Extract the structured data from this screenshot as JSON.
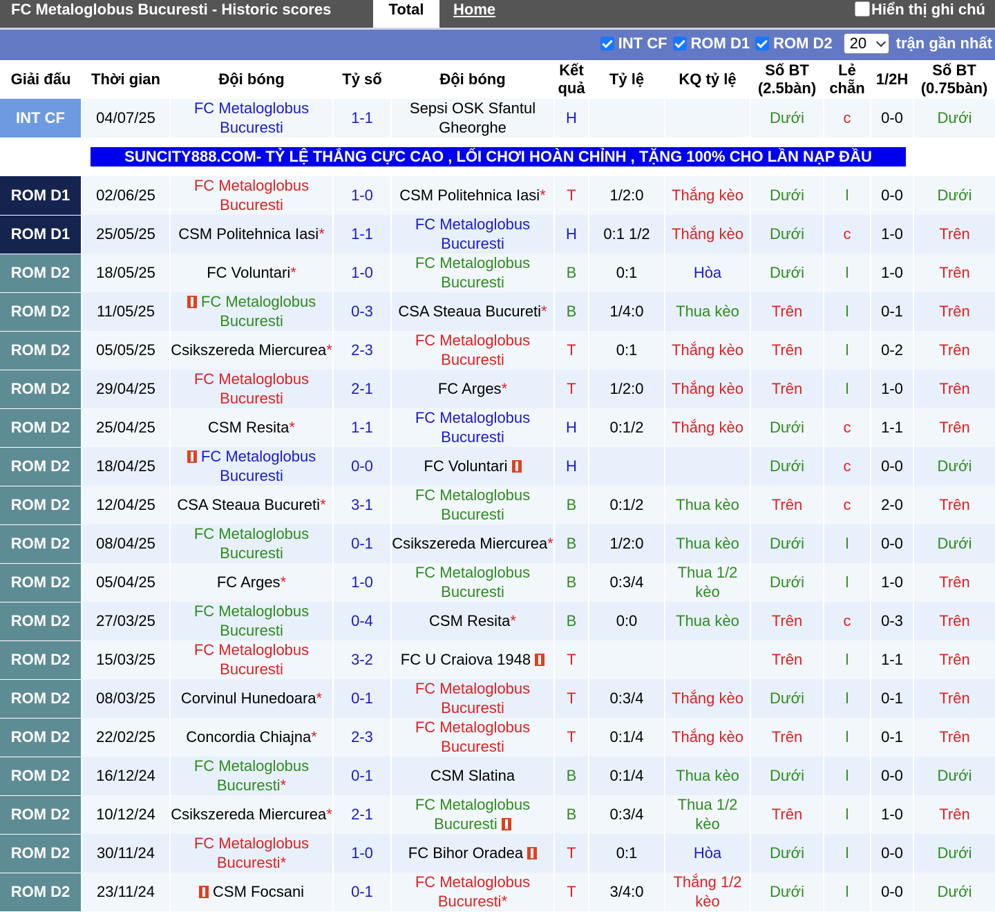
{
  "header": {
    "title": "FC Metaloglobus Bucuresti - Historic scores",
    "tab_total": "Total",
    "tab_home": "Home",
    "show_notes": "Hiển thị ghi chú"
  },
  "filters": {
    "items": [
      "INT CF",
      "ROM D1",
      "ROM D2"
    ],
    "count_value": "20",
    "count_suffix": "trận gần nhất"
  },
  "columns": [
    "Giải đấu",
    "Thời gian",
    "Đội bóng",
    "Tỷ số",
    "Đội bóng",
    "Kết quả",
    "Tỷ lệ",
    "KQ tỷ lệ",
    "Số BT (2.5bàn)",
    "Lẻ chẵn",
    "1/2H",
    "Số BT (0.75bàn)"
  ],
  "ad_text": "SUNCITY888.COM- TỶ LỆ THẮNG CỰC CAO , LỐI CHƠI HOÀN CHỈNH , TẶNG 100% CHO LẦN NẠP ĐẦU",
  "colors": {
    "INT CF": "#6d9ae0",
    "ROM D1": "#15244f",
    "ROM D2": "#5e8c94"
  },
  "matches": [
    {
      "league": "INT CF",
      "date": "04/07/25",
      "home": "FC Metaloglobus Bucuresti",
      "home_c": "blue",
      "score": "1-1",
      "away": "Sepsi OSK Sfantul Gheorghe",
      "away_c": "black",
      "res": "H",
      "res_c": "blue",
      "hc": "",
      "hc_res": "",
      "hc_res_c": "",
      "ou": "Dưới",
      "ou_c": "green",
      "oe": "c",
      "oe_c": "red",
      "ht": "0-0",
      "ou2": "Dưới",
      "ou2_c": "green"
    },
    {
      "league": "ROM D1",
      "date": "02/06/25",
      "home": "FC Metaloglobus Bucuresti",
      "home_c": "red",
      "score": "1-0",
      "away": "CSM Politehnica Iasi",
      "away_star": true,
      "away_c": "black",
      "res": "T",
      "res_c": "red",
      "hc": "1/2:0",
      "hc_res": "Thắng kèo",
      "hc_res_c": "red",
      "ou": "Dưới",
      "ou_c": "green",
      "oe": "l",
      "oe_c": "green",
      "ht": "0-0",
      "ou2": "Dưới",
      "ou2_c": "green"
    },
    {
      "league": "ROM D1",
      "date": "25/05/25",
      "home": "CSM Politehnica Iasi",
      "home_star": true,
      "home_c": "black",
      "score": "1-1",
      "away": "FC Metaloglobus Bucuresti",
      "away_c": "blue",
      "res": "H",
      "res_c": "blue",
      "hc": "0:1 1/2",
      "hc_res": "Thắng kèo",
      "hc_res_c": "red",
      "ou": "Dưới",
      "ou_c": "green",
      "oe": "c",
      "oe_c": "red",
      "ht": "1-0",
      "ou2": "Trên",
      "ou2_c": "red"
    },
    {
      "league": "ROM D2",
      "date": "18/05/25",
      "home": "FC Voluntari",
      "home_star": true,
      "home_c": "black",
      "score": "1-0",
      "away": "FC Metaloglobus Bucuresti",
      "away_c": "green",
      "res": "B",
      "res_c": "green",
      "hc": "0:1",
      "hc_res": "Hòa",
      "hc_res_c": "blue",
      "ou": "Dưới",
      "ou_c": "green",
      "oe": "l",
      "oe_c": "green",
      "ht": "1-0",
      "ou2": "Trên",
      "ou2_c": "red"
    },
    {
      "league": "ROM D2",
      "date": "11/05/25",
      "home": "FC Metaloglobus Bucuresti",
      "home_flag": true,
      "home_c": "green",
      "score": "0-3",
      "away": "CSA Steaua Bucureti",
      "away_star": true,
      "away_c": "black",
      "res": "B",
      "res_c": "green",
      "hc": "1/4:0",
      "hc_res": "Thua kèo",
      "hc_res_c": "green",
      "ou": "Trên",
      "ou_c": "red",
      "oe": "l",
      "oe_c": "green",
      "ht": "0-1",
      "ou2": "Trên",
      "ou2_c": "red"
    },
    {
      "league": "ROM D2",
      "date": "05/05/25",
      "home": "Csikszereda Miercurea",
      "home_star": true,
      "home_c": "black",
      "score": "2-3",
      "away": "FC Metaloglobus Bucuresti",
      "away_c": "red",
      "res": "T",
      "res_c": "red",
      "hc": "0:1",
      "hc_res": "Thắng kèo",
      "hc_res_c": "red",
      "ou": "Trên",
      "ou_c": "red",
      "oe": "l",
      "oe_c": "green",
      "ht": "0-2",
      "ou2": "Trên",
      "ou2_c": "red"
    },
    {
      "league": "ROM D2",
      "date": "29/04/25",
      "home": "FC Metaloglobus Bucuresti",
      "home_c": "red",
      "score": "2-1",
      "away": "FC Arges",
      "away_star": true,
      "away_c": "black",
      "res": "T",
      "res_c": "red",
      "hc": "1/2:0",
      "hc_res": "Thắng kèo",
      "hc_res_c": "red",
      "ou": "Trên",
      "ou_c": "red",
      "oe": "l",
      "oe_c": "green",
      "ht": "1-0",
      "ou2": "Trên",
      "ou2_c": "red"
    },
    {
      "league": "ROM D2",
      "date": "25/04/25",
      "home": "CSM Resita",
      "home_star": true,
      "home_c": "black",
      "score": "1-1",
      "away": "FC Metaloglobus Bucuresti",
      "away_c": "blue",
      "res": "H",
      "res_c": "blue",
      "hc": "0:1/2",
      "hc_res": "Thắng kèo",
      "hc_res_c": "red",
      "ou": "Dưới",
      "ou_c": "green",
      "oe": "c",
      "oe_c": "red",
      "ht": "1-1",
      "ou2": "Trên",
      "ou2_c": "red"
    },
    {
      "league": "ROM D2",
      "date": "18/04/25",
      "home": "FC Metaloglobus Bucuresti",
      "home_flag": true,
      "home_c": "blue",
      "score": "0-0",
      "away": "FC Voluntari",
      "away_flag": true,
      "away_c": "black",
      "res": "H",
      "res_c": "blue",
      "hc": "",
      "hc_res": "",
      "hc_res_c": "",
      "ou": "Dưới",
      "ou_c": "green",
      "oe": "c",
      "oe_c": "red",
      "ht": "0-0",
      "ou2": "Dưới",
      "ou2_c": "green"
    },
    {
      "league": "ROM D2",
      "date": "12/04/25",
      "home": "CSA Steaua Bucureti",
      "home_star": true,
      "home_c": "black",
      "score": "3-1",
      "away": "FC Metaloglobus Bucuresti",
      "away_c": "green",
      "res": "B",
      "res_c": "green",
      "hc": "0:1/2",
      "hc_res": "Thua kèo",
      "hc_res_c": "green",
      "ou": "Trên",
      "ou_c": "red",
      "oe": "c",
      "oe_c": "red",
      "ht": "2-0",
      "ou2": "Trên",
      "ou2_c": "red"
    },
    {
      "league": "ROM D2",
      "date": "08/04/25",
      "home": "FC Metaloglobus Bucuresti",
      "home_c": "green",
      "score": "0-1",
      "away": "Csikszereda Miercurea",
      "away_star": true,
      "away_c": "black",
      "res": "B",
      "res_c": "green",
      "hc": "1/2:0",
      "hc_res": "Thua kèo",
      "hc_res_c": "green",
      "ou": "Dưới",
      "ou_c": "green",
      "oe": "l",
      "oe_c": "green",
      "ht": "0-0",
      "ou2": "Dưới",
      "ou2_c": "green"
    },
    {
      "league": "ROM D2",
      "date": "05/04/25",
      "home": "FC Arges",
      "home_star": true,
      "home_c": "black",
      "score": "1-0",
      "away": "FC Metaloglobus Bucuresti",
      "away_c": "green",
      "res": "B",
      "res_c": "green",
      "hc": "0:3/4",
      "hc_res": "Thua 1/2 kèo",
      "hc_res_c": "green",
      "ou": "Dưới",
      "ou_c": "green",
      "oe": "l",
      "oe_c": "green",
      "ht": "1-0",
      "ou2": "Trên",
      "ou2_c": "red"
    },
    {
      "league": "ROM D2",
      "date": "27/03/25",
      "home": "FC Metaloglobus Bucuresti",
      "home_c": "green",
      "score": "0-4",
      "away": "CSM Resita",
      "away_star": true,
      "away_c": "black",
      "res": "B",
      "res_c": "green",
      "hc": "0:0",
      "hc_res": "Thua kèo",
      "hc_res_c": "green",
      "ou": "Trên",
      "ou_c": "red",
      "oe": "c",
      "oe_c": "red",
      "ht": "0-3",
      "ou2": "Trên",
      "ou2_c": "red"
    },
    {
      "league": "ROM D2",
      "date": "15/03/25",
      "home": "FC Metaloglobus Bucuresti",
      "home_c": "red",
      "score": "3-2",
      "away": "FC U Craiova 1948",
      "away_flag": true,
      "away_c": "black",
      "res": "T",
      "res_c": "red",
      "hc": "",
      "hc_res": "",
      "hc_res_c": "",
      "ou": "Trên",
      "ou_c": "red",
      "oe": "l",
      "oe_c": "green",
      "ht": "1-1",
      "ou2": "Trên",
      "ou2_c": "red"
    },
    {
      "league": "ROM D2",
      "date": "08/03/25",
      "home": "Corvinul Hunedoara",
      "home_star": true,
      "home_c": "black",
      "score": "0-1",
      "away": "FC Metaloglobus Bucuresti",
      "away_c": "red",
      "res": "T",
      "res_c": "red",
      "hc": "0:3/4",
      "hc_res": "Thắng kèo",
      "hc_res_c": "red",
      "ou": "Dưới",
      "ou_c": "green",
      "oe": "l",
      "oe_c": "green",
      "ht": "0-1",
      "ou2": "Trên",
      "ou2_c": "red"
    },
    {
      "league": "ROM D2",
      "date": "22/02/25",
      "home": "Concordia Chiajna",
      "home_star": true,
      "home_c": "black",
      "score": "2-3",
      "away": "FC Metaloglobus Bucuresti",
      "away_c": "red",
      "res": "T",
      "res_c": "red",
      "hc": "0:1/4",
      "hc_res": "Thắng kèo",
      "hc_res_c": "red",
      "ou": "Trên",
      "ou_c": "red",
      "oe": "l",
      "oe_c": "green",
      "ht": "0-1",
      "ou2": "Trên",
      "ou2_c": "red"
    },
    {
      "league": "ROM D2",
      "date": "16/12/24",
      "home": "FC Metaloglobus Bucuresti",
      "home_star": true,
      "home_c": "green",
      "score": "0-1",
      "away": "CSM Slatina",
      "away_c": "black",
      "res": "B",
      "res_c": "green",
      "hc": "0:1/4",
      "hc_res": "Thua kèo",
      "hc_res_c": "green",
      "ou": "Dưới",
      "ou_c": "green",
      "oe": "l",
      "oe_c": "green",
      "ht": "0-0",
      "ou2": "Dưới",
      "ou2_c": "green"
    },
    {
      "league": "ROM D2",
      "date": "10/12/24",
      "home": "Csikszereda Miercurea",
      "home_star": true,
      "home_c": "black",
      "score": "2-1",
      "away": "FC Metaloglobus Bucuresti",
      "away_flag": true,
      "away_c": "green",
      "res": "B",
      "res_c": "green",
      "hc": "0:3/4",
      "hc_res": "Thua 1/2 kèo",
      "hc_res_c": "green",
      "ou": "Trên",
      "ou_c": "red",
      "oe": "l",
      "oe_c": "green",
      "ht": "1-0",
      "ou2": "Trên",
      "ou2_c": "red"
    },
    {
      "league": "ROM D2",
      "date": "30/11/24",
      "home": "FC Metaloglobus Bucuresti",
      "home_star": true,
      "home_c": "red",
      "score": "1-0",
      "away": "FC Bihor Oradea",
      "away_flag": true,
      "away_c": "black",
      "res": "T",
      "res_c": "red",
      "hc": "0:1",
      "hc_res": "Hòa",
      "hc_res_c": "blue",
      "ou": "Dưới",
      "ou_c": "green",
      "oe": "l",
      "oe_c": "green",
      "ht": "0-0",
      "ou2": "Dưới",
      "ou2_c": "green"
    },
    {
      "league": "ROM D2",
      "date": "23/11/24",
      "home": "CSM Focsani",
      "home_flag": true,
      "home_flag_left": true,
      "home_c": "black",
      "score": "0-1",
      "away": "FC Metaloglobus Bucuresti",
      "away_star": true,
      "away_c": "red",
      "res": "T",
      "res_c": "red",
      "hc": "3/4:0",
      "hc_res": "Thắng 1/2 kèo",
      "hc_res_c": "red",
      "ou": "Dưới",
      "ou_c": "green",
      "oe": "l",
      "oe_c": "green",
      "ht": "0-0",
      "ou2": "Dưới",
      "ou2_c": "green"
    }
  ]
}
